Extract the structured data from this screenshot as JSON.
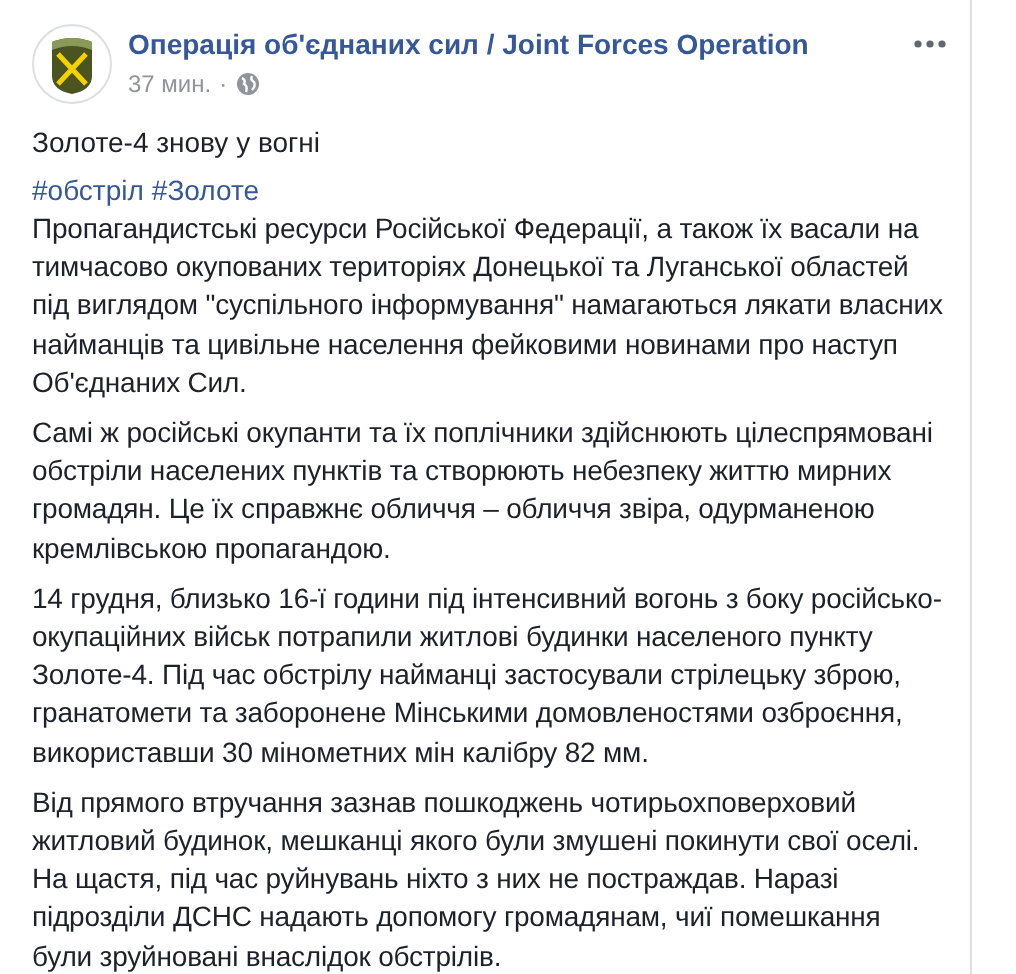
{
  "post": {
    "author": "Операція об'єднаних сил / Joint Forces Operation",
    "time": "37 мин.",
    "separator": "·",
    "title": "Золоте-4 знову у вогні",
    "hashtags": [
      "#обстріл",
      "#Золоте"
    ],
    "paragraphs": [
      "Пропагандистські ресурси Російської Федерації, а також їх васали на тимчасово окупованих територіях Донецької та Луганської областей під виглядом \"суспільного інформування\" намагаються лякати власних найманців та цивільне населення фейковими новинами про наступ Об'єднаних Сил.",
      "Самі ж російські окупанти та їх поплічники здійснюють цілеспрямовані обстріли населених пунктів та створюють небезпеку життю мирних громадян. Це їх справжнє обличчя – обличчя звіра, одурманеною кремлівською пропагандою.",
      "14 грудня, близько 16-ї години під інтенсивний вогонь з боку російсько-окупаційних військ потрапили житлові будинки населеного пункту Золоте-4. Під час обстрілу найманці застосували стрілецьку зброю, гранатомети та заборонене Мінськими домовленостями озброєння, використавши 30 мінометних мін калібру 82 мм.",
      "Від прямого втручання зазнав пошкоджень чотирьохповерховий житловий будинок, мешканці якого були змушені покинути свої оселі. На щастя, під час руйнувань ніхто з них не постраждав. Наразі підрозділи ДСНС надають допомогу громадянам, чиї помешкання були зруйновані внаслідок обстрілів."
    ]
  }
}
